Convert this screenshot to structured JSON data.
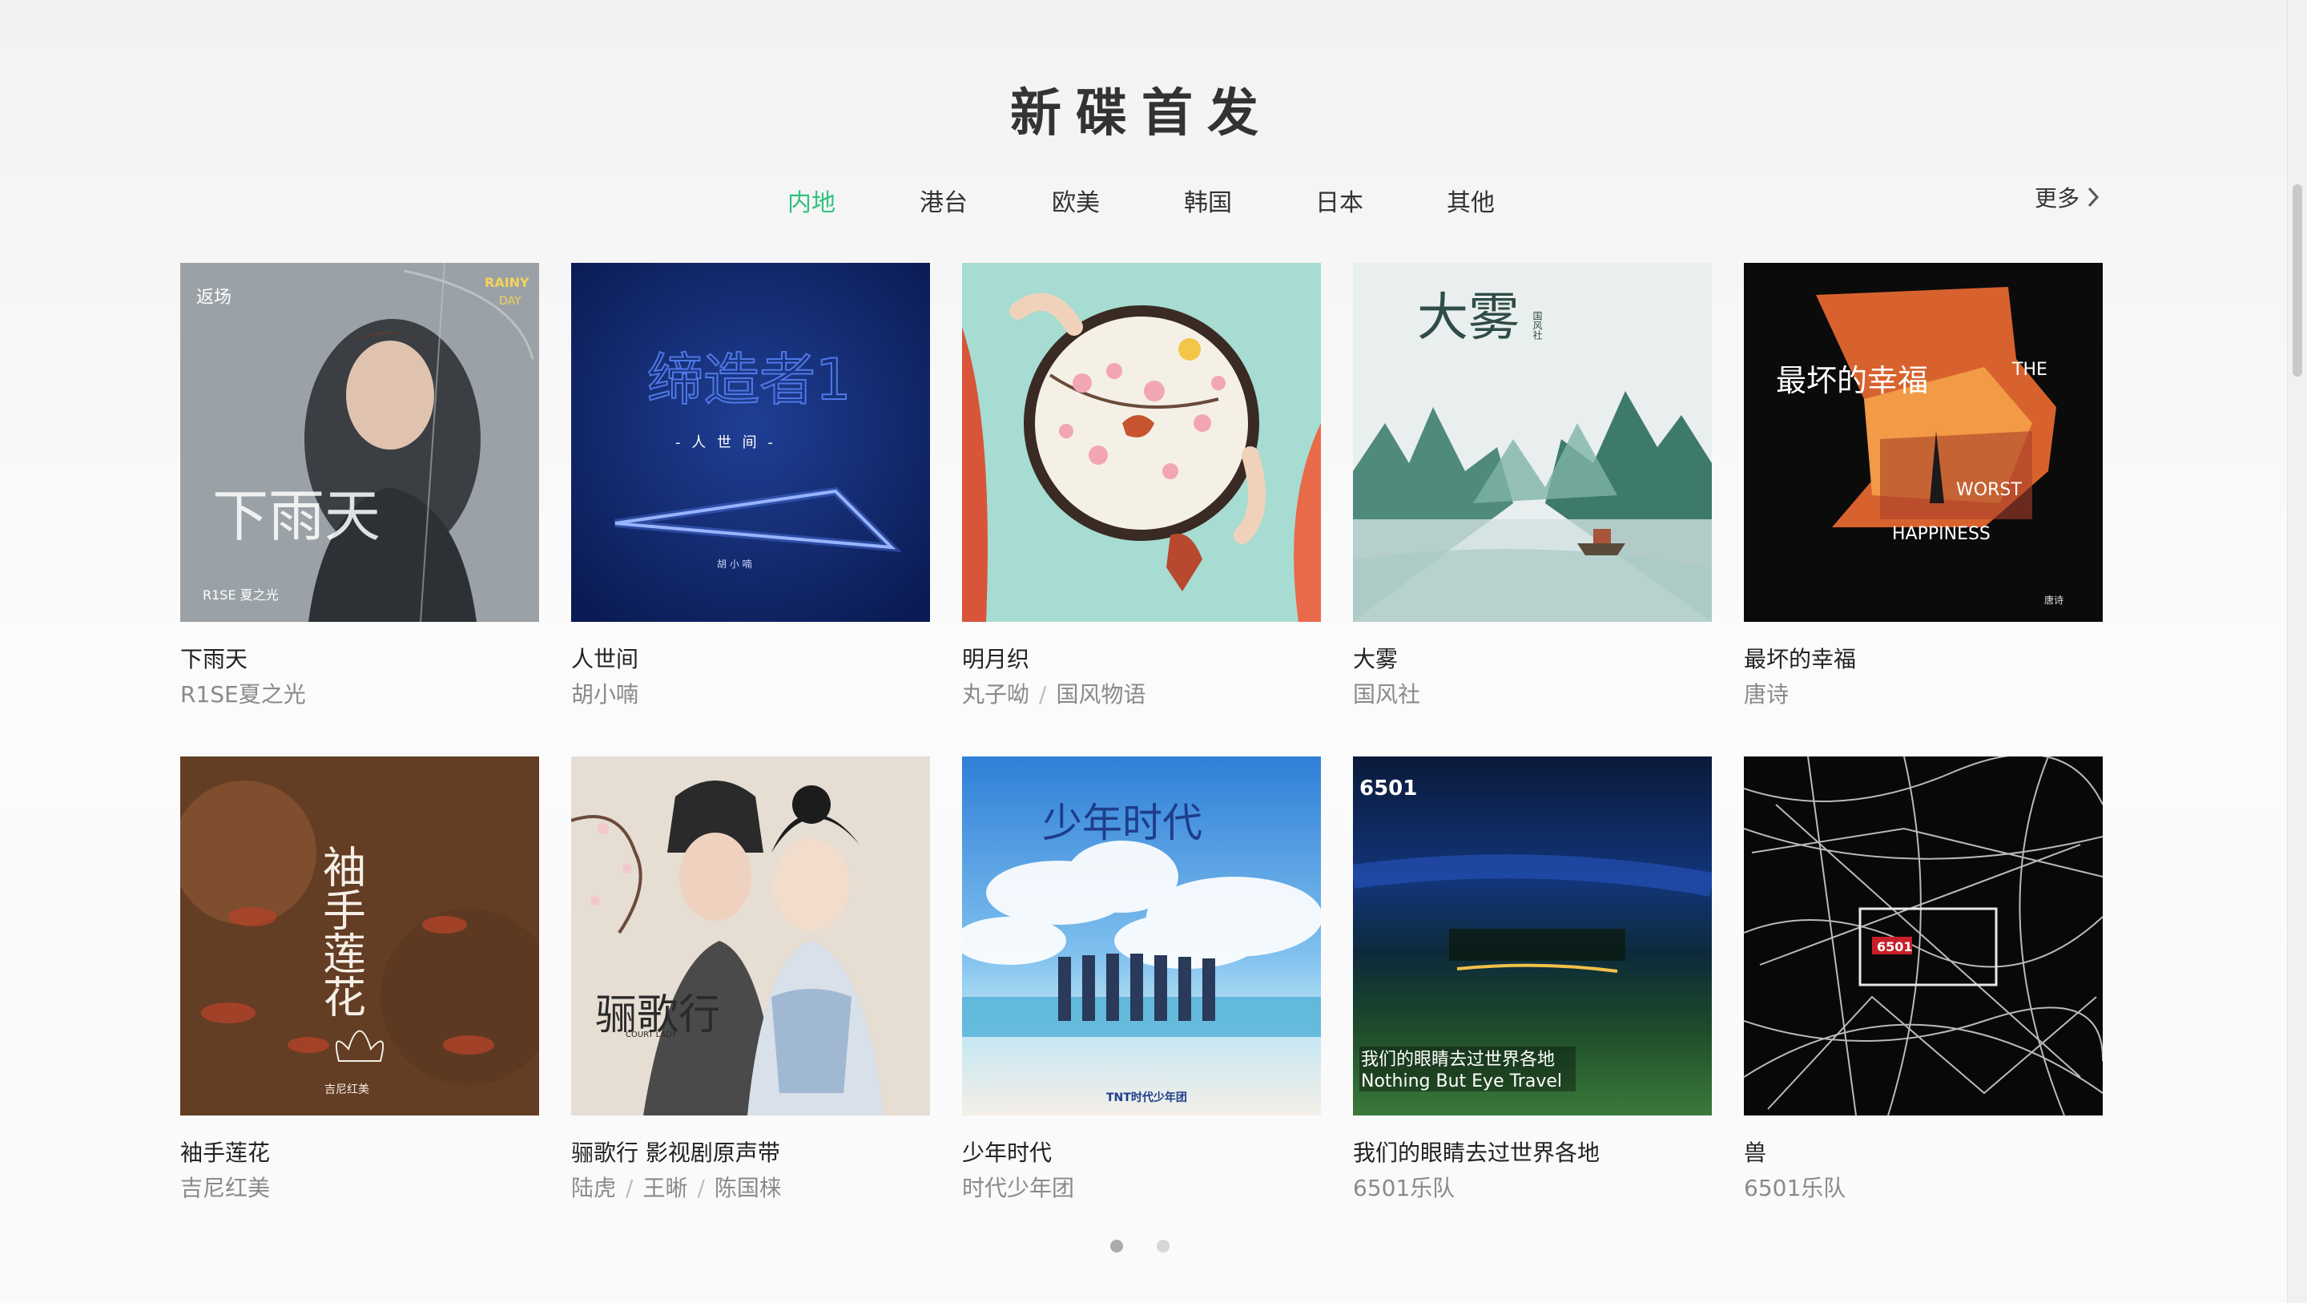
{
  "section": {
    "title": "新碟首发"
  },
  "tabs": [
    {
      "label": "内地",
      "active": true
    },
    {
      "label": "港台",
      "active": false
    },
    {
      "label": "欧美",
      "active": false
    },
    {
      "label": "韩国",
      "active": false
    },
    {
      "label": "日本",
      "active": false
    },
    {
      "label": "其他",
      "active": false
    }
  ],
  "more": {
    "label": "更多",
    "icon": "chevron-right-icon"
  },
  "accent_color": "#31c27c",
  "albums": [
    {
      "name": "下雨天",
      "artists": [
        "R1SE夏之光"
      ],
      "cover_text": {
        "title": "下雨天",
        "corner": "RAINY",
        "corner2": "DAY",
        "badge": "R1SE 夏之光"
      }
    },
    {
      "name": "人世间",
      "artists": [
        "胡小喃"
      ],
      "cover_text": {
        "title": "缔造者1",
        "subtitle": "- 人 世 间 -",
        "artist": "胡 小 喃"
      }
    },
    {
      "name": "明月织",
      "artists": [
        "丸子呦",
        "国风物语"
      ],
      "cover_text": {}
    },
    {
      "name": "大雾",
      "artists": [
        "国风社"
      ],
      "cover_text": {
        "title": "大雾",
        "label": "国风社"
      }
    },
    {
      "name": "最坏的幸福",
      "artists": [
        "唐诗"
      ],
      "cover_text": {
        "cn": "最坏的幸福",
        "en1": "THE",
        "en2": "WORST",
        "en3": "HAPPINESS",
        "artist": "唐诗"
      }
    },
    {
      "name": "袖手莲花",
      "artists": [
        "吉尼红美"
      ],
      "cover_text": {
        "title": "袖手莲花",
        "artist": "吉尼红美"
      }
    },
    {
      "name": "骊歌行 影视剧原声带",
      "artists": [
        "陆虎",
        "王晰",
        "陈国梾"
      ],
      "cover_text": {
        "title": "骊歌行",
        "en": "COURT LADY"
      }
    },
    {
      "name": "少年时代",
      "artists": [
        "时代少年团"
      ],
      "cover_text": {
        "title": "少年时代",
        "logo": "TNT时代少年团"
      }
    },
    {
      "name": "我们的眼睛去过世界各地",
      "artists": [
        "6501乐队"
      ],
      "cover_text": {
        "logo": "6501",
        "cn": "我们的眼睛去过世界各地",
        "en": "Nothing But Eye Travel"
      }
    },
    {
      "name": "兽",
      "artists": [
        "6501乐队"
      ],
      "cover_text": {
        "logo": "6501"
      }
    }
  ],
  "pagination": {
    "pages": 2,
    "current": 1
  }
}
